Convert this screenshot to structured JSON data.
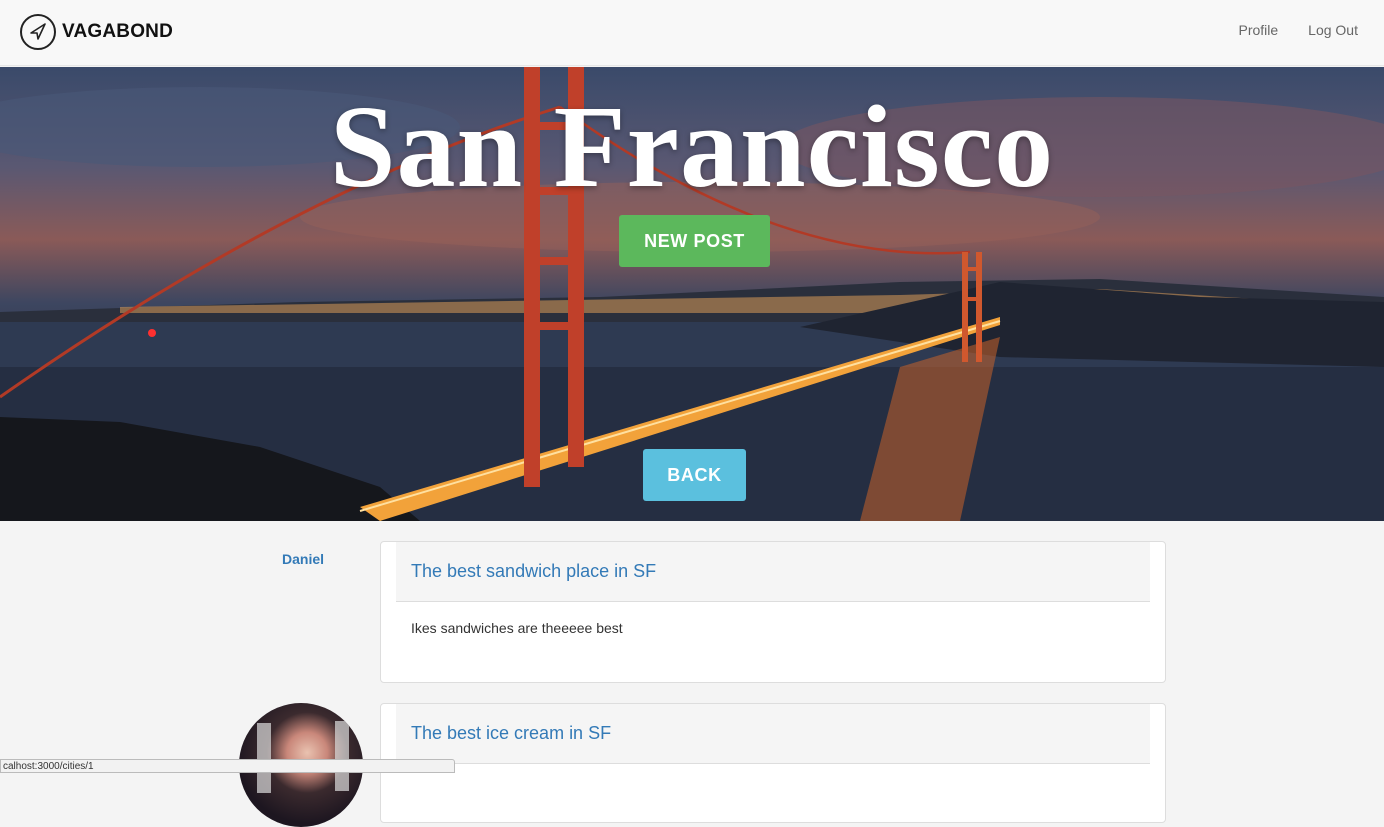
{
  "navbar": {
    "brand": "VAGABOND",
    "links": [
      "Profile",
      "Log Out"
    ]
  },
  "hero": {
    "title": "San Francisco",
    "new_post_label": "NEW POST",
    "back_label": "BACK"
  },
  "posts": [
    {
      "author": "Daniel",
      "title": "The best sandwich place in SF",
      "body": "Ikes sandwiches are theeeee best"
    },
    {
      "author": "",
      "title": "The best ice cream in SF",
      "body": ""
    }
  ],
  "status_bar": {
    "url": "calhost:3000/cities/1"
  },
  "icons": {
    "brand_logo": "navigation-arrow-icon"
  },
  "colors": {
    "new_post": "#5cb85c",
    "back": "#5bc0de",
    "link": "#337ab7"
  }
}
